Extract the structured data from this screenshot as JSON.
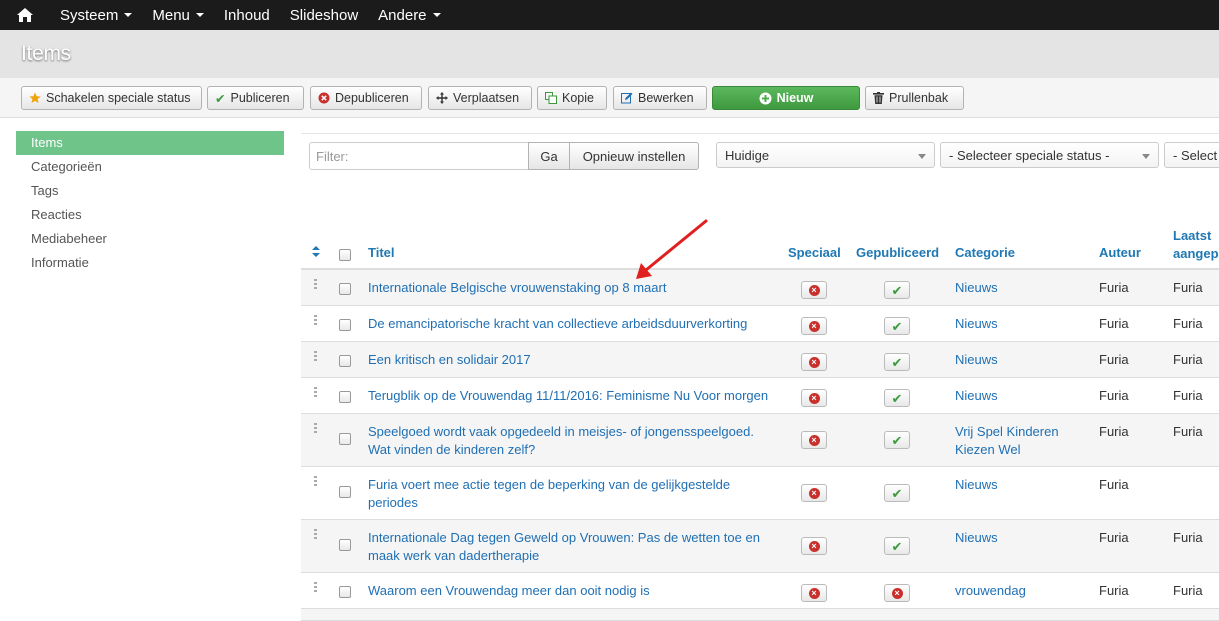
{
  "navbar": {
    "home_icon": "home-icon",
    "items": [
      {
        "label": "Systeem",
        "dropdown": true
      },
      {
        "label": "Menu",
        "dropdown": true
      },
      {
        "label": "Inhoud",
        "dropdown": false
      },
      {
        "label": "Slideshow",
        "dropdown": false
      },
      {
        "label": "Andere",
        "dropdown": true
      }
    ]
  },
  "header": {
    "title": "Items"
  },
  "toolbar": {
    "feature_label": "Schakelen speciale status",
    "publish_label": "Publiceren",
    "unpublish_label": "Depubliceren",
    "move_label": "Verplaatsen",
    "copy_label": "Kopie",
    "edit_label": "Bewerken",
    "new_label": "Nieuw",
    "trash_label": "Prullenbak"
  },
  "sidebar": {
    "items": [
      {
        "label": "Items",
        "active": true
      },
      {
        "label": "Categorieën",
        "active": false
      },
      {
        "label": "Tags",
        "active": false
      },
      {
        "label": "Reacties",
        "active": false
      },
      {
        "label": "Mediabeheer",
        "active": false
      },
      {
        "label": "Informatie",
        "active": false
      }
    ]
  },
  "filters": {
    "search_placeholder": "Filter:",
    "go_label": "Ga",
    "reset_label": "Opnieuw instellen",
    "select_1": "Huidige",
    "select_2": "- Selecteer speciale status -",
    "select_3": "- Select"
  },
  "table": {
    "headers": {
      "titel": "Titel",
      "speciaal": "Speciaal",
      "gepubliceerd": "Gepubliceerd",
      "categorie": "Categorie",
      "auteur": "Auteur",
      "laatst_line1": "Laatst",
      "laatst_line2": "aangepast"
    },
    "rows": [
      {
        "title": "Internationale Belgische vrouwenstaking op 8 maart",
        "title2": "",
        "special": false,
        "published": true,
        "category": "Nieuws",
        "category2": "",
        "author": "Furia",
        "modified_by": "Furia"
      },
      {
        "title": "De emancipatorische kracht van collectieve arbeidsduurverkorting",
        "title2": "",
        "special": false,
        "published": true,
        "category": "Nieuws",
        "category2": "",
        "author": "Furia",
        "modified_by": "Furia"
      },
      {
        "title": "Een kritisch en solidair 2017",
        "title2": "",
        "special": false,
        "published": true,
        "category": "Nieuws",
        "category2": "",
        "author": "Furia",
        "modified_by": "Furia"
      },
      {
        "title": "Terugblik op de Vrouwendag 11/11/2016: Feminisme Nu Voor morgen",
        "title2": "",
        "special": false,
        "published": true,
        "category": "Nieuws",
        "category2": "",
        "author": "Furia",
        "modified_by": "Furia"
      },
      {
        "title": "Speelgoed wordt vaak opgedeeld in meisjes- of jongensspeelgoed.",
        "title2": "Wat vinden de kinderen zelf?",
        "special": false,
        "published": true,
        "category": "Vrij Spel Kinderen",
        "category2": "Kiezen Wel",
        "author": "Furia",
        "modified_by": "Furia"
      },
      {
        "title": "Furia voert mee actie tegen de beperking van de gelijkgestelde",
        "title2": "periodes",
        "special": false,
        "published": true,
        "category": "Nieuws",
        "category2": "",
        "author": "Furia",
        "modified_by": ""
      },
      {
        "title": "Internationale Dag tegen Geweld op Vrouwen: Pas de wetten toe en",
        "title2": "maak werk van dadertherapie",
        "special": false,
        "published": true,
        "category": "Nieuws",
        "category2": "",
        "author": "Furia",
        "modified_by": "Furia"
      },
      {
        "title": "Waarom een Vrouwendag meer dan ooit nodig is",
        "title2": "",
        "special": false,
        "published": false,
        "category": "vrouwendag",
        "category2": "",
        "author": "Furia",
        "modified_by": "Furia"
      }
    ]
  },
  "colors": {
    "navbar_bg": "#1b1b1b",
    "sidebar_active": "#6fc48a",
    "link": "#1f6fb4",
    "new_button": "#4cae4c",
    "annotation_arrow": "#e02020"
  }
}
